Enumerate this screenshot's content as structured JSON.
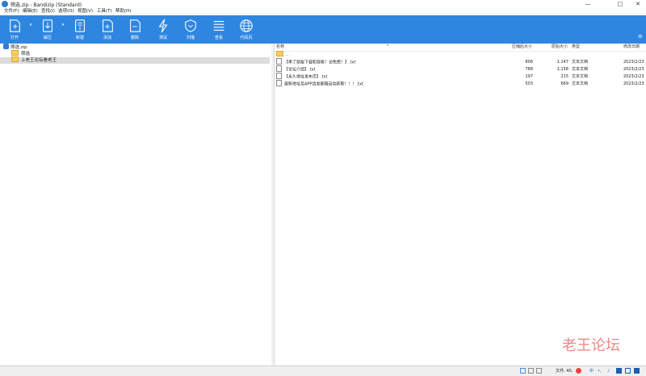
{
  "window": {
    "title": "筛选.zip - Bandizip (Standard)",
    "min": "—",
    "max": "□",
    "close": "✕"
  },
  "menu": {
    "items": [
      {
        "label": "文件(F)"
      },
      {
        "label": "编辑(E)"
      },
      {
        "label": "查找(I)"
      },
      {
        "label": "选项(O)"
      },
      {
        "label": "视图(V)"
      },
      {
        "label": "工具(T)"
      },
      {
        "label": "帮助(H)"
      }
    ]
  },
  "toolbar": {
    "buttons": [
      {
        "label": "打开",
        "icon": "open-icon"
      },
      {
        "label": "解压",
        "icon": "extract-icon"
      },
      {
        "label": "新建",
        "icon": "new-icon"
      },
      {
        "label": "添加",
        "icon": "add-icon"
      },
      {
        "label": "删除",
        "icon": "delete-icon"
      },
      {
        "label": "测试",
        "icon": "test-icon"
      },
      {
        "label": "扫描",
        "icon": "scan-icon"
      },
      {
        "label": "查看",
        "icon": "view-icon"
      },
      {
        "label": "代码页",
        "icon": "codepage-icon"
      }
    ],
    "accent": "#2f86e0"
  },
  "tree": {
    "root": "筛选.zip",
    "children": [
      {
        "label": "筛选"
      },
      {
        "label": "上老王论坛看老王"
      }
    ]
  },
  "list": {
    "headers": {
      "name": "名称",
      "packed": "压缩后大小",
      "original": "原始大小",
      "type": "类型",
      "modified": "修改日期"
    },
    "parent": "..",
    "rows": [
      {
        "name": "【串了就能下载和观看！访免费！】.txt",
        "packed": "806",
        "original": "1,147",
        "type": "文本文档",
        "modified": "2023/2/23"
      },
      {
        "name": "【论坛介绍】.txt",
        "packed": "788",
        "original": "1,158",
        "type": "文本文档",
        "modified": "2023/2/23"
      },
      {
        "name": "【永久地址发布页】.txt",
        "packed": "197",
        "original": "215",
        "type": "文本文档",
        "modified": "2023/2/23"
      },
      {
        "name": "最新地址及APP请发邮箱自动获取！！！.txt",
        "packed": "503",
        "original": "669",
        "type": "文本文档",
        "modified": "2023/2/23"
      }
    ]
  },
  "status": {
    "files": "文件: 40,",
    "ime": "中"
  },
  "watermark": "老王论坛"
}
